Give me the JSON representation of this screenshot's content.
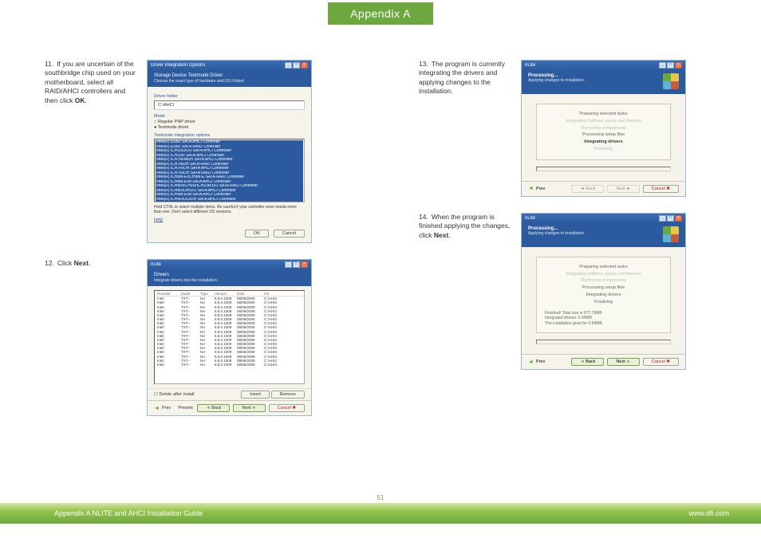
{
  "header": {
    "title": "Appendix A"
  },
  "page_number": "51",
  "footer": {
    "left": "Appendix A NLITE and AHCI Installation Guide",
    "right": "www.dfi.com"
  },
  "steps": {
    "s11": {
      "num": "11.",
      "text_a": "If you are uncertain of the southbridge chip used on your motherboard, select all RAID/AHCI controllers and then click ",
      "bold": "OK",
      "text_b": "."
    },
    "s12": {
      "num": "12.",
      "text_a": "Click ",
      "bold": "Next",
      "text_b": "."
    },
    "s13": {
      "num": "13.",
      "text_a": "The program is currently integrating the drivers and applying changes to the installation."
    },
    "s14": {
      "num": "14.",
      "text_a": "When the program is finished applying the changes, click ",
      "bold": "Next",
      "text_b": "."
    }
  },
  "dlg11": {
    "title": "Driver Integration Options",
    "header": "Storage Device Textmode Driver",
    "header_sub": "Choose the exact type of hardware and OS if listed",
    "folder_label": "Driver folder",
    "folder": "C:\\AHCI",
    "mode_label": "Mode",
    "radio1": "Regular PNP driver",
    "radio2": "Textmode driver",
    "options_label": "Textmode integration options",
    "list": [
      "Intel(R) ESB2 SATA AHCI Controller",
      "Intel(R) ESB2 SATA RAID Controller",
      "Intel(R) ICH10D/DO SATA AHCI Controller",
      "Intel(R) ICH10R SATA AHCI Controller",
      "Intel(R) ICH7M/MDH SATA AHCI Controller",
      "Intel(R) ICH7MDH SATA RAID Controller",
      "Intel(R) ICH7R/DH SATA AHCI Controller",
      "Intel(R) ICH7R/DH SATA RAID Controller",
      "Intel(R) ICH8M-E/ICH9M-E SATA RAID Controller",
      "Intel(R) ICH8M-E/M SATA AHCI Controller",
      "Intel(R) ICH8R/ICH9R/ICH10R/DO SATA RAID Controller",
      "Intel(R) ICH8R/DH/DO SATA AHCI Controller",
      "Intel(R) ICH9M-E/M SATA AHCI Controller",
      "Intel(R) ICH9R/DO/DH SATA AHCI Controller",
      "Intel(R) PCH SATA AHCI Controller",
      "Intel(R) PCH SATA RAID Controller 4 Port",
      "Intel(R) PCH SATA RAID Controller 6 Port"
    ],
    "note": "Hold CTRL to select multiple items. Be careful if your controller even needs more than one. Don't select different OS versions.",
    "help": "Help",
    "ok": "OK",
    "cancel": "Cancel"
  },
  "dlg12": {
    "title": "nLite",
    "header": "Drivers",
    "header_sub": "Integrate drivers into the installation.",
    "cols": {
      "prov": "Provider",
      "mode": "Mode",
      "type": "Type",
      "ver": "Version",
      "date": "Date",
      "os": "OS"
    },
    "rows": [
      [
        "Intel",
        "TXT--",
        "NA",
        "8.8.0.1009",
        "08/06/2009",
        "C:\\AHCI"
      ],
      [
        "Intel",
        "TXT--",
        "NA",
        "8.8.0.1009",
        "08/06/2009",
        "C:\\AHCI"
      ],
      [
        "Intel",
        "TXT--",
        "NA",
        "8.8.0.1009",
        "08/06/2009",
        "C:\\AHCI"
      ],
      [
        "Intel",
        "TXT--",
        "NA",
        "8.8.0.1009",
        "08/06/2009",
        "C:\\AHCI"
      ],
      [
        "Intel",
        "TXT--",
        "NA",
        "8.8.0.1009",
        "08/06/2009",
        "C:\\AHCI"
      ],
      [
        "Intel",
        "TXT--",
        "NA",
        "8.8.0.1009",
        "08/06/2009",
        "C:\\AHCI"
      ],
      [
        "Intel",
        "TXT--",
        "NA",
        "8.8.0.1009",
        "08/06/2009",
        "C:\\AHCI"
      ],
      [
        "Intel",
        "TXT--",
        "NA",
        "8.8.0.1009",
        "08/06/2009",
        "C:\\AHCI"
      ],
      [
        "Intel",
        "TXT--",
        "NA",
        "8.8.0.1009",
        "08/06/2009",
        "C:\\AHCI"
      ],
      [
        "Intel",
        "TXT--",
        "NA",
        "8.8.0.1009",
        "08/06/2009",
        "C:\\AHCI"
      ],
      [
        "Intel",
        "TXT--",
        "NA",
        "8.8.0.1009",
        "08/06/2009",
        "C:\\AHCI"
      ],
      [
        "Intel",
        "TXT--",
        "NA",
        "8.8.0.1009",
        "08/06/2009",
        "C:\\AHCI"
      ],
      [
        "Intel",
        "TXT--",
        "NA",
        "8.8.0.1009",
        "08/06/2009",
        "C:\\AHCI"
      ],
      [
        "Intel",
        "TXT--",
        "NA",
        "8.8.0.1009",
        "08/06/2009",
        "C:\\AHCI"
      ],
      [
        "Intel",
        "TXT--",
        "NA",
        "8.8.0.1009",
        "08/06/2009",
        "C:\\AHCI"
      ],
      [
        "Intel",
        "TXT--",
        "NA",
        "8.8.0.1009",
        "08/06/2009",
        "C:\\AHCI"
      ],
      [
        "Intel",
        "TXT--",
        "NA",
        "8.8.0.1009",
        "08/06/2009",
        "C:\\AHCI"
      ]
    ],
    "checkbox": "Delete after install",
    "insert": "Insert",
    "remove": "Remove",
    "prev_label": "Prev",
    "presets": "Presets",
    "back": "Back",
    "next": "Next",
    "cancel": "Cancel"
  },
  "proc": {
    "title": "nLite",
    "header": "Processing...",
    "header_sub": "Applying changes to installation.",
    "tasks": {
      "t1": "Preparing selected tasks",
      "t2": "Integrating hotfixes, packs and themes",
      "t3": "Removing components",
      "t4": "Processing setup files",
      "t5": "Integrating drivers",
      "t6": "Finalizing"
    },
    "stats": {
      "s1": "Finished! Total size is 677.79MB",
      "s2": "Integrated drivers: 0.04MB",
      "s3": "The installation grew for 0.04MB."
    },
    "prev": "Prev",
    "back": "Back",
    "next": "Next",
    "cancel": "Cancel"
  }
}
